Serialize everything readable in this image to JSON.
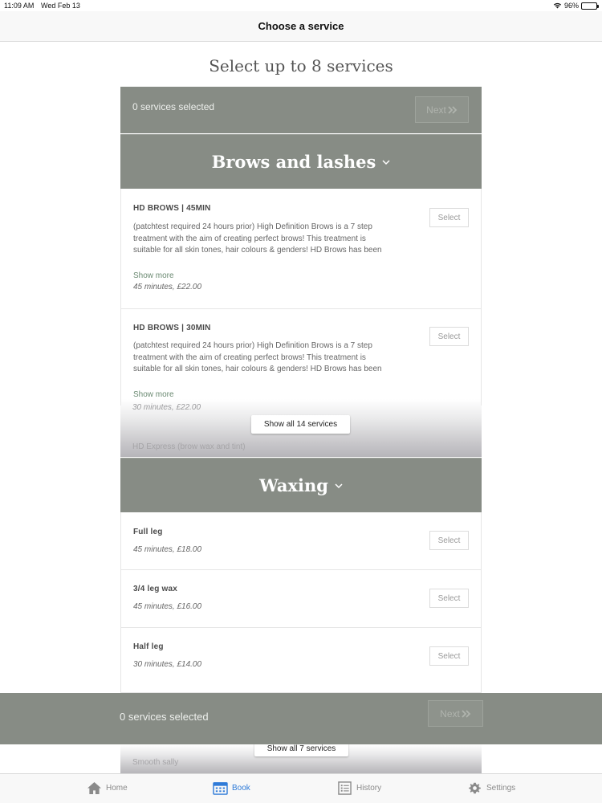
{
  "status_bar": {
    "time": "11:09 AM",
    "date": "Wed Feb 13",
    "battery": "96%"
  },
  "nav": {
    "title": "Choose a service"
  },
  "heading": "Select up to 8 services",
  "selection": {
    "count_text": "0 services selected",
    "next_label": "Next"
  },
  "categories": [
    {
      "title": "Brows and lashes",
      "services": [
        {
          "name": "HD BROWS | 45MIN",
          "description": "(patchtest required 24 hours prior) High Definition Brows is a 7 step treatment with the aim of creating perfect brows! This treatment is suitable for all skin tones, hair colours & genders! HD Brows has been voted the best eyebrow treatment supplier in The Guild",
          "show_more": "Show more",
          "meta": "45 minutes, £22.00",
          "select_label": "Select"
        },
        {
          "name": "HD BROWS | 30MIN",
          "description": "(patchtest required 24 hours prior) High Definition Brows is a 7 step treatment with the aim of creating perfect brows! This treatment is suitable for all skin tones, hair colours & genders! HD Brows has been voted the best eyebrow treatment supplier in The Guild",
          "show_more": "Show more",
          "meta": "30 minutes, £22.00",
          "select_label": "Select"
        }
      ],
      "faded_hint": "HD Express (brow wax and tint)",
      "show_all_label": "Show all 14 services"
    },
    {
      "title": "Waxing",
      "services": [
        {
          "name": "Full leg",
          "meta": "45 minutes, £18.00",
          "select_label": "Select"
        },
        {
          "name": "3/4 leg wax",
          "meta": "45 minutes, £16.00",
          "select_label": "Select"
        },
        {
          "name": "Half leg",
          "meta": "30 minutes, £14.00",
          "select_label": "Select"
        }
      ],
      "faded_hint": "Smooth sally",
      "show_all_label": "Show all 7 services"
    }
  ],
  "tabs": [
    {
      "label": "Home",
      "icon": "home-icon"
    },
    {
      "label": "Book",
      "icon": "calendar-icon",
      "active": true
    },
    {
      "label": "History",
      "icon": "history-icon"
    },
    {
      "label": "Settings",
      "icon": "gear-icon"
    }
  ],
  "colors": {
    "panel": "#878c85",
    "accent": "#2f7bd8",
    "link": "#6b8a72"
  }
}
